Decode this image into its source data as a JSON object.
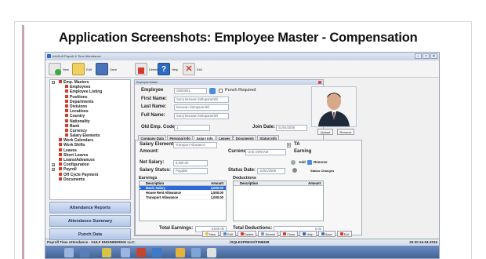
{
  "slide": {
    "title": "Application Screenshots: Employee Master - Compensation"
  },
  "app_window": {
    "title": "InfoSoft Payroll & Time Attendance",
    "controls": [
      "–",
      "□",
      "✕"
    ],
    "toolbar": {
      "new_label": "New",
      "edit_label": "Edit",
      "save_label": "Save",
      "delete_label": "Delete",
      "help_label": "Help",
      "exit_label": "Exit"
    }
  },
  "sidebar": {
    "tree": [
      {
        "label": "Emp. Masters",
        "level": 0,
        "expander": "−"
      },
      {
        "label": "Employees",
        "level": 1
      },
      {
        "label": "Employee Listing",
        "level": 1
      },
      {
        "label": "Positions",
        "level": 1
      },
      {
        "label": "Departments",
        "level": 1
      },
      {
        "label": "Divisions",
        "level": 1
      },
      {
        "label": "Locations",
        "level": 1
      },
      {
        "label": "Country",
        "level": 1
      },
      {
        "label": "Nationality",
        "level": 1
      },
      {
        "label": "Bank",
        "level": 1
      },
      {
        "label": "Currency",
        "level": 1
      },
      {
        "label": "Salary Elements",
        "level": 1
      },
      {
        "label": "Work Calendars",
        "level": 0
      },
      {
        "label": "Work Shifts",
        "level": 0
      },
      {
        "label": "Leaves",
        "level": 0
      },
      {
        "label": "Short Leaves",
        "level": 0
      },
      {
        "label": "Loans/Advances",
        "level": 0
      },
      {
        "label": "Configuration",
        "level": 0,
        "expander": "+"
      },
      {
        "label": "Payroll",
        "level": 0,
        "expander": "+"
      },
      {
        "label": "Off Cycle Payment",
        "level": 0
      },
      {
        "label": "Documents",
        "level": 0
      }
    ],
    "buttons": [
      "Attendance Reports",
      "Attendance Summary",
      "Punch Data"
    ]
  },
  "employee_form": {
    "header": "Employee Master",
    "employee_label": "Employee",
    "employee_code": "GB00001",
    "punch_required_label": "Punch Required",
    "first_name_label": "First Name:",
    "first_name": "Suroj kesavan kottuparambil",
    "last_name_label": "Last Name:",
    "last_name": "kesavan kottuparambil",
    "full_name_label": "Full Name:",
    "full_name": "Suroj kesavan kottuparambil",
    "old_emp_code_label": "Old Emp. Code:",
    "old_emp_code": "1",
    "join_date_label": "Join Date:",
    "join_date": "01/04/2008",
    "upload_label": "Upload",
    "remove_label": "Remove",
    "tabs": [
      "Company Data",
      "Personal Info",
      "Salary Info",
      "Leaves",
      "Documents",
      "Status Info"
    ],
    "active_tab": "Salary Info"
  },
  "salary_info": {
    "salary_element_label": "Salary Element:",
    "salary_element": "Transport Allowance",
    "ta_label": "TA",
    "amount_label": "Amount:",
    "currency_label": "Currency:",
    "currency": "UAE DIRHAM",
    "earning_label": "Earning",
    "net_salary_label": "Net Salary:",
    "net_salary": "6,500.00",
    "add_label": "Add",
    "remove_label": "Remove",
    "salary_status_label": "Salary Status:",
    "salary_status": "Payable",
    "status_date_label": "Status Date:",
    "status_date": "10/01/2008",
    "status_changes_label": "Status Changes",
    "earnings_title": "Earnings",
    "deductions_title": "Deductions",
    "earnings_columns": [
      "Description",
      "Amount"
    ],
    "deductions_columns": [
      "Description",
      "Amount"
    ],
    "earnings_rows": [
      {
        "description": "Basic Salary",
        "amount": "4,000.00"
      },
      {
        "description": "House Rent Allowance",
        "amount": "1,500.00"
      },
      {
        "description": "Transport Allowance",
        "amount": "1,000.00"
      }
    ],
    "total_earnings_label": "Total Earnings:",
    "total_earnings": "6,500.00",
    "total_deductions_label": "Total Deductions:",
    "total_deductions": "0.00"
  },
  "bottom_toolbar": [
    "New",
    "Edit",
    "Delete",
    "Search",
    "Close",
    "Help",
    "Save",
    "Exit"
  ],
  "status_bar": {
    "left": "Payroll Time Attendance - GULF ENGINEERING LLC:",
    "center": ".\\SQLEXPRESS\\TIMEDB",
    "right": "20:20 24-04-2016"
  },
  "colors": {
    "accent_bar": "#c8a4ad",
    "tree_icon": "#d23a2a",
    "selection": "#2b6ad8"
  }
}
